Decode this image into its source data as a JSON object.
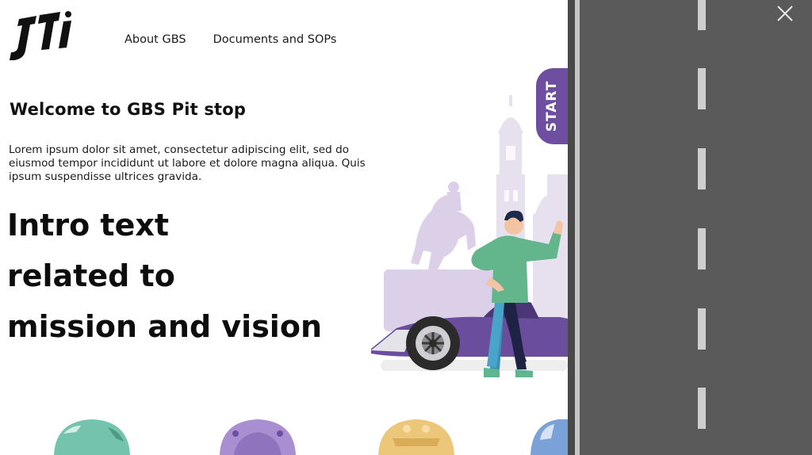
{
  "brand": {
    "logo_text": "JTI"
  },
  "nav": {
    "items": [
      "About GBS",
      "Documents and SOPs"
    ]
  },
  "welcome": {
    "title": "Welcome to GBS Pit stop",
    "body": "Lorem ipsum dolor sit amet, consectetur adipiscing elit, sed do eiusmod tempor incididunt ut labore et dolore magna aliqua. Quis ipsum suspendisse ultrices gravida."
  },
  "intro": {
    "lines": [
      "Intro text",
      "related to",
      "mission and vision"
    ]
  },
  "start": {
    "label": "START"
  },
  "colors": {
    "accent": "#6d4ea0",
    "road": "#5a5a5a",
    "helmets": [
      "#74c4ad",
      "#a98fd1",
      "#ecc77a",
      "#7aa2d8"
    ]
  },
  "icons": {
    "close": "close-icon"
  }
}
